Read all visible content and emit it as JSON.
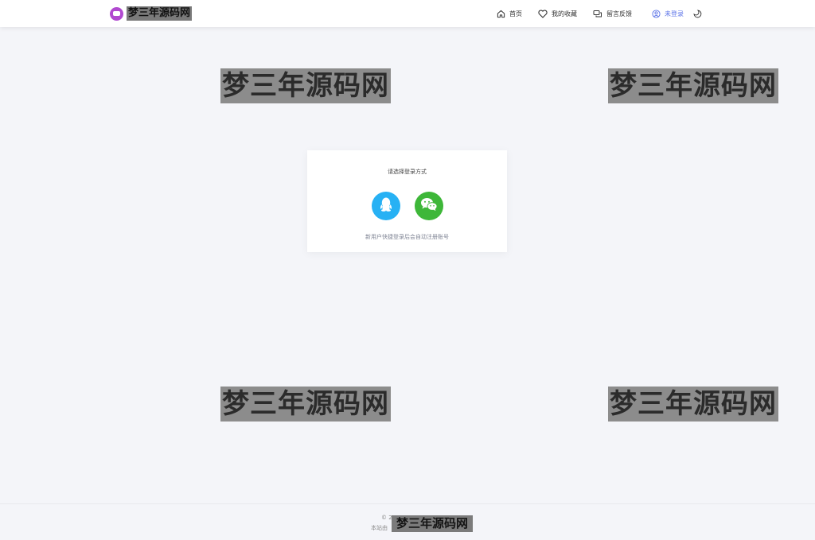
{
  "header": {
    "logo_text": "梦三年源码网",
    "nav": {
      "home": "首页",
      "favorites": "我的收藏",
      "feedback": "留言反馈",
      "login": "未登录"
    }
  },
  "watermark": "梦三年源码网",
  "login_card": {
    "title": "请选择登录方式",
    "note": "新用户快捷登录后会自动注册账号",
    "methods": [
      {
        "icon": "qq-icon",
        "color": "#27b1f4"
      },
      {
        "icon": "wechat-icon",
        "color": "#3eb739"
      }
    ]
  },
  "footer": {
    "copyright": "© 2",
    "site": "本站由",
    "watermark": "梦三年源码网"
  },
  "colors": {
    "accent": "#5b73e8",
    "logo": "#b149d0",
    "background": "#f4f5f9"
  }
}
